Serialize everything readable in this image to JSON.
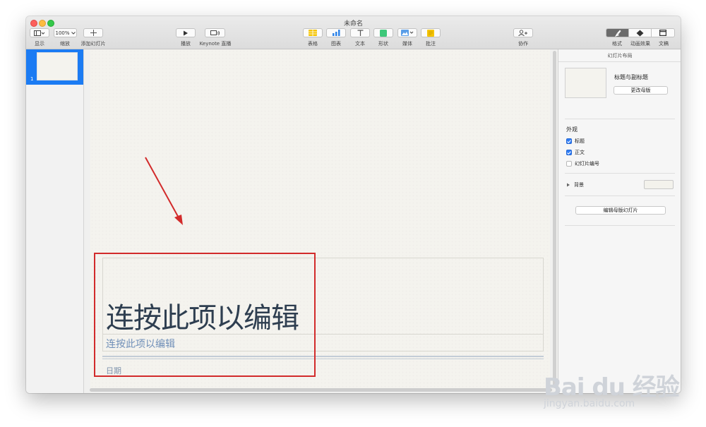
{
  "window": {
    "title": "未命名"
  },
  "toolbar": {
    "view_label": "显示",
    "zoom_value": "100%",
    "zoom_label": "缩放",
    "add_slide_label": "添加幻灯片",
    "play_label": "播放",
    "keynote_live_label": "Keynote 直播",
    "table_label": "表格",
    "chart_label": "图表",
    "text_label": "文本",
    "shape_label": "形状",
    "media_label": "媒体",
    "comment_label": "批注",
    "collaborate_label": "协作",
    "format_label": "格式",
    "animate_label": "动画效果",
    "document_label": "文稿"
  },
  "navigator": {
    "slide_number": "1"
  },
  "slide": {
    "title": "连按此项以编辑",
    "subtitle": "连按此项以编辑",
    "date": "日期"
  },
  "inspector": {
    "header": "幻灯片布局",
    "layout_name": "标题与副标题",
    "change_master_label": "更改母版",
    "appearance_title": "外观",
    "checkboxes": [
      {
        "label": "标题",
        "checked": true
      },
      {
        "label": "正文",
        "checked": true
      },
      {
        "label": "幻灯片编号",
        "checked": false
      }
    ],
    "background_label": "背景",
    "edit_master_label": "编辑母版幻灯片",
    "background_color": "#f3f2ec"
  },
  "watermark": {
    "main": "Bai du 经验",
    "sub": "jingyan.baidu.com"
  },
  "colors": {
    "selection": "#1b7bf3",
    "annotation": "#d22b2b",
    "checkbox": "#2f7df6"
  }
}
